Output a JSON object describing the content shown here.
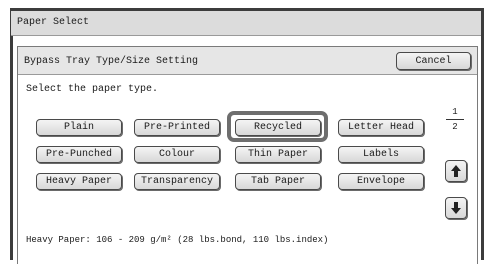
{
  "window": {
    "title": "Paper Select"
  },
  "subheader": {
    "title": "Bypass Tray Type/Size Setting",
    "cancel_label": "Cancel"
  },
  "prompt": "Select the paper type.",
  "paper_types": {
    "row1": [
      "Plain",
      "Pre-Printed",
      "Recycled",
      "Letter Head"
    ],
    "row2": [
      "Pre-Punched",
      "Colour",
      "Thin Paper",
      "Labels"
    ],
    "row3": [
      "Heavy Paper",
      "Transparency",
      "Tab Paper",
      "Envelope"
    ],
    "selected": "Recycled"
  },
  "pager": {
    "current": "1",
    "total": "2"
  },
  "icons": {
    "up": "arrow-up-icon",
    "down": "arrow-down-icon"
  },
  "footer": "Heavy Paper: 106 - 209 g/m² (28 lbs.bond, 110 lbs.index)"
}
